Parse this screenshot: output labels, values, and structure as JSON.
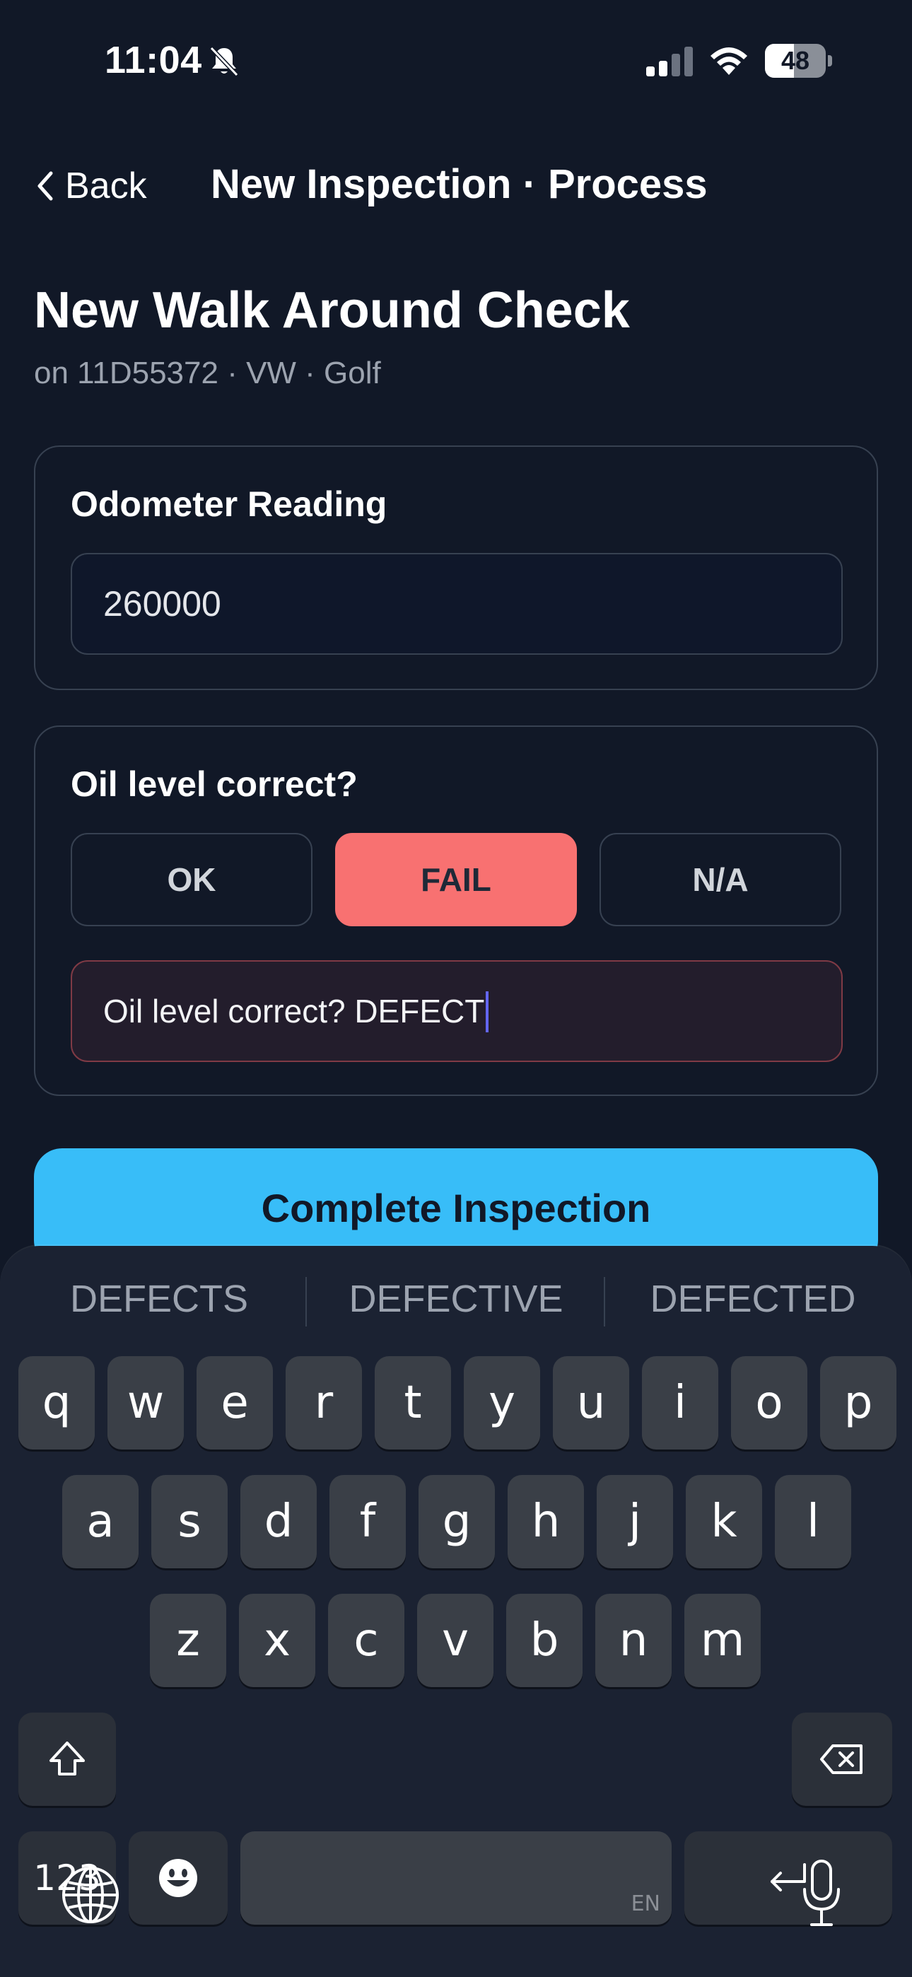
{
  "status_bar": {
    "time": "11:04",
    "battery": "48",
    "battery_fraction": 0.48
  },
  "nav": {
    "back_label": "Back",
    "title": "New Inspection · Process"
  },
  "header": {
    "title": "New Walk Around Check",
    "subtitle": "on 11D55372 · VW · Golf"
  },
  "odometer": {
    "label": "Odometer Reading",
    "value": "260000"
  },
  "oil_check": {
    "label": "Oil level correct?",
    "options": [
      "OK",
      "FAIL",
      "N/A"
    ],
    "selected": "FAIL",
    "defect_note": "Oil level correct? DEFECT"
  },
  "actions": {
    "complete_label": "Complete Inspection"
  },
  "keyboard": {
    "suggestions": [
      "DEFECTS",
      "DEFECTIVE",
      "DEFECTED"
    ],
    "row1": [
      "q",
      "w",
      "e",
      "r",
      "t",
      "y",
      "u",
      "i",
      "o",
      "p"
    ],
    "row2": [
      "a",
      "s",
      "d",
      "f",
      "g",
      "h",
      "j",
      "k",
      "l"
    ],
    "row3": [
      "z",
      "x",
      "c",
      "v",
      "b",
      "n",
      "m"
    ],
    "numbers_label": "123",
    "space_hint": "EN",
    "icons": {
      "shift": "shift-icon",
      "delete": "backspace-icon",
      "emoji": "emoji-icon",
      "return": "return-icon",
      "globe": "globe-icon",
      "mic": "microphone-icon"
    }
  },
  "colors": {
    "background": "#111827",
    "accent": "#38bdf8",
    "fail": "#f87171",
    "caret": "#6366f1"
  }
}
